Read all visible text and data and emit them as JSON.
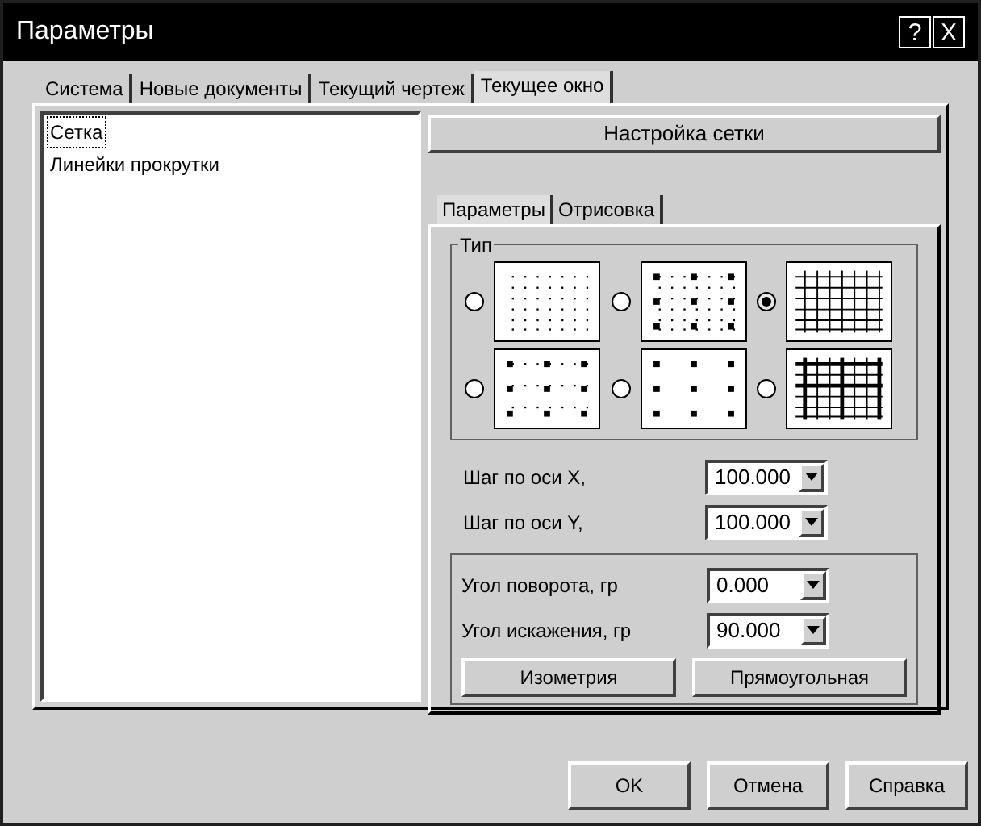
{
  "window": {
    "title": "Параметры",
    "help_button": "?",
    "close_button": "X"
  },
  "tabs": [
    {
      "label": "Система",
      "selected": false
    },
    {
      "label": "Новые документы",
      "selected": false
    },
    {
      "label": "Текущий чертеж",
      "selected": false
    },
    {
      "label": "Текущее окно",
      "selected": true
    }
  ],
  "tree": {
    "items": [
      {
        "label": "Сетка",
        "selected": true
      },
      {
        "label": "Линейки прокрутки",
        "selected": false
      }
    ]
  },
  "panel": {
    "header": "Настройка сетки",
    "tabs": [
      {
        "label": "Параметры",
        "selected": true
      },
      {
        "label": "Отрисовка",
        "selected": false
      }
    ],
    "type_group": {
      "title": "Тип",
      "options": [
        {
          "kind": "dots",
          "selected": false
        },
        {
          "kind": "dots-major",
          "selected": false
        },
        {
          "kind": "lines",
          "selected": true
        },
        {
          "kind": "dots-major-sparse",
          "selected": false
        },
        {
          "kind": "major-only",
          "selected": false
        },
        {
          "kind": "lines-major",
          "selected": false
        }
      ]
    },
    "steps": [
      {
        "label": "Шаг по оси X,",
        "value": "100.000"
      },
      {
        "label": "Шаг по оси Y,",
        "value": "100.000"
      }
    ],
    "angles": [
      {
        "label": "Угол поворота, гр",
        "value": "0.000"
      },
      {
        "label": "Угол искажения, гр",
        "value": "90.000"
      }
    ],
    "buttons": [
      "Изометрия",
      "Прямоугольная"
    ]
  },
  "buttons": [
    "OK",
    "Отмена",
    "Справка"
  ]
}
